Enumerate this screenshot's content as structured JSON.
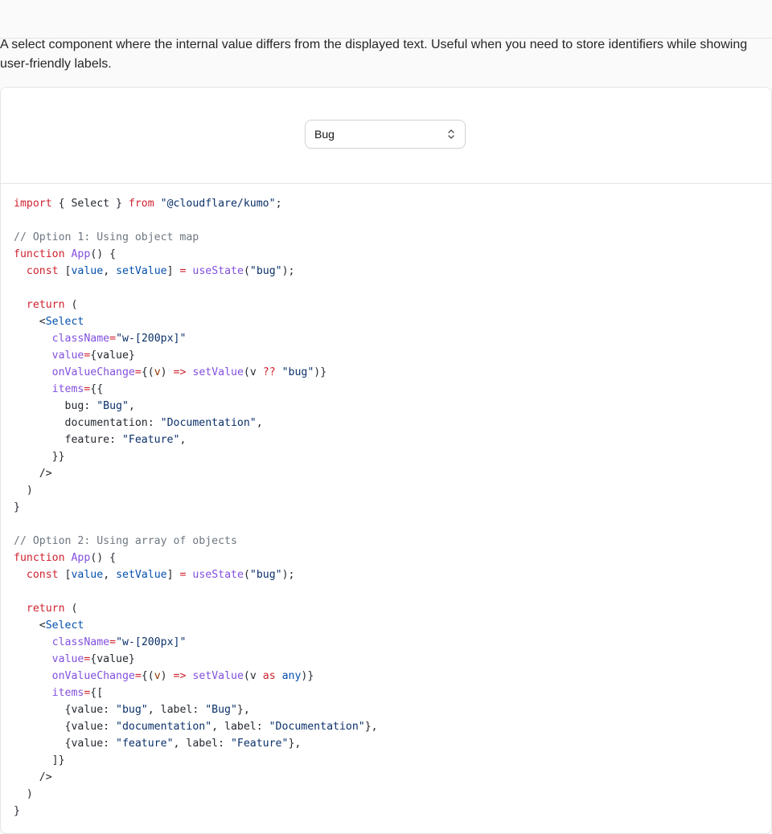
{
  "description": "A select component where the internal value differs from the displayed text. Useful when you need to store identifiers while showing user-friendly labels.",
  "select": {
    "value": "Bug",
    "icon": "chevron-up-down-icon"
  },
  "code_lines": [
    [
      [
        "kw",
        "import"
      ],
      [
        "p",
        " { Select } "
      ],
      [
        "kw",
        "from"
      ],
      [
        "p",
        " "
      ],
      [
        "str",
        "\"@cloudflare/kumo\""
      ],
      [
        "p",
        ";"
      ]
    ],
    [],
    [
      [
        "cm",
        "// Option 1: Using object map"
      ]
    ],
    [
      [
        "kw",
        "function"
      ],
      [
        "p",
        " "
      ],
      [
        "fn",
        "App"
      ],
      [
        "p",
        "() {"
      ]
    ],
    [
      [
        "p",
        "  "
      ],
      [
        "kw",
        "const"
      ],
      [
        "p",
        " ["
      ],
      [
        "var",
        "value"
      ],
      [
        "p",
        ", "
      ],
      [
        "var",
        "setValue"
      ],
      [
        "p",
        "] "
      ],
      [
        "kw",
        "="
      ],
      [
        "p",
        " "
      ],
      [
        "fn",
        "useState"
      ],
      [
        "p",
        "("
      ],
      [
        "str",
        "\"bug\""
      ],
      [
        "p",
        ");"
      ]
    ],
    [],
    [
      [
        "p",
        "  "
      ],
      [
        "kw",
        "return"
      ],
      [
        "p",
        " ("
      ]
    ],
    [
      [
        "p",
        "    <"
      ],
      [
        "tagn",
        "Select"
      ]
    ],
    [
      [
        "p",
        "      "
      ],
      [
        "attr",
        "className"
      ],
      [
        "kw",
        "="
      ],
      [
        "str",
        "\"w-[200px]\""
      ]
    ],
    [
      [
        "p",
        "      "
      ],
      [
        "attr",
        "value"
      ],
      [
        "kw",
        "="
      ],
      [
        "p",
        "{value}"
      ]
    ],
    [
      [
        "p",
        "      "
      ],
      [
        "attr",
        "onValueChange"
      ],
      [
        "kw",
        "="
      ],
      [
        "p",
        "{("
      ],
      [
        "par",
        "v"
      ],
      [
        "p",
        ") "
      ],
      [
        "kw",
        "=>"
      ],
      [
        "p",
        " "
      ],
      [
        "fn",
        "setValue"
      ],
      [
        "p",
        "(v "
      ],
      [
        "kw",
        "??"
      ],
      [
        "p",
        " "
      ],
      [
        "str",
        "\"bug\""
      ],
      [
        "p",
        ")}"
      ]
    ],
    [
      [
        "p",
        "      "
      ],
      [
        "attr",
        "items"
      ],
      [
        "kw",
        "="
      ],
      [
        "p",
        "{{"
      ]
    ],
    [
      [
        "p",
        "        bug: "
      ],
      [
        "str",
        "\"Bug\""
      ],
      [
        "p",
        ","
      ]
    ],
    [
      [
        "p",
        "        documentation: "
      ],
      [
        "str",
        "\"Documentation\""
      ],
      [
        "p",
        ","
      ]
    ],
    [
      [
        "p",
        "        feature: "
      ],
      [
        "str",
        "\"Feature\""
      ],
      [
        "p",
        ","
      ]
    ],
    [
      [
        "p",
        "      }}"
      ]
    ],
    [
      [
        "p",
        "    />"
      ]
    ],
    [
      [
        "p",
        "  )"
      ]
    ],
    [
      [
        "p",
        "}"
      ]
    ],
    [],
    [
      [
        "cm",
        "// Option 2: Using array of objects"
      ]
    ],
    [
      [
        "kw",
        "function"
      ],
      [
        "p",
        " "
      ],
      [
        "fn",
        "App"
      ],
      [
        "p",
        "() {"
      ]
    ],
    [
      [
        "p",
        "  "
      ],
      [
        "kw",
        "const"
      ],
      [
        "p",
        " ["
      ],
      [
        "var",
        "value"
      ],
      [
        "p",
        ", "
      ],
      [
        "var",
        "setValue"
      ],
      [
        "p",
        "] "
      ],
      [
        "kw",
        "="
      ],
      [
        "p",
        " "
      ],
      [
        "fn",
        "useState"
      ],
      [
        "p",
        "("
      ],
      [
        "str",
        "\"bug\""
      ],
      [
        "p",
        ");"
      ]
    ],
    [],
    [
      [
        "p",
        "  "
      ],
      [
        "kw",
        "return"
      ],
      [
        "p",
        " ("
      ]
    ],
    [
      [
        "p",
        "    <"
      ],
      [
        "tagn",
        "Select"
      ]
    ],
    [
      [
        "p",
        "      "
      ],
      [
        "attr",
        "className"
      ],
      [
        "kw",
        "="
      ],
      [
        "str",
        "\"w-[200px]\""
      ]
    ],
    [
      [
        "p",
        "      "
      ],
      [
        "attr",
        "value"
      ],
      [
        "kw",
        "="
      ],
      [
        "p",
        "{value}"
      ]
    ],
    [
      [
        "p",
        "      "
      ],
      [
        "attr",
        "onValueChange"
      ],
      [
        "kw",
        "="
      ],
      [
        "p",
        "{("
      ],
      [
        "par",
        "v"
      ],
      [
        "p",
        ") "
      ],
      [
        "kw",
        "=>"
      ],
      [
        "p",
        " "
      ],
      [
        "fn",
        "setValue"
      ],
      [
        "p",
        "(v "
      ],
      [
        "kw",
        "as"
      ],
      [
        "p",
        " "
      ],
      [
        "var",
        "any"
      ],
      [
        "p",
        ")}"
      ]
    ],
    [
      [
        "p",
        "      "
      ],
      [
        "attr",
        "items"
      ],
      [
        "kw",
        "="
      ],
      [
        "p",
        "{["
      ]
    ],
    [
      [
        "p",
        "        {value: "
      ],
      [
        "str",
        "\"bug\""
      ],
      [
        "p",
        ", label: "
      ],
      [
        "str",
        "\"Bug\""
      ],
      [
        "p",
        "},"
      ]
    ],
    [
      [
        "p",
        "        {value: "
      ],
      [
        "str",
        "\"documentation\""
      ],
      [
        "p",
        ", label: "
      ],
      [
        "str",
        "\"Documentation\""
      ],
      [
        "p",
        "},"
      ]
    ],
    [
      [
        "p",
        "        {value: "
      ],
      [
        "str",
        "\"feature\""
      ],
      [
        "p",
        ", label: "
      ],
      [
        "str",
        "\"Feature\""
      ],
      [
        "p",
        "},"
      ]
    ],
    [
      [
        "p",
        "      ]}"
      ]
    ],
    [
      [
        "p",
        "    />"
      ]
    ],
    [
      [
        "p",
        "  )"
      ]
    ],
    [
      [
        "p",
        "}"
      ]
    ]
  ]
}
